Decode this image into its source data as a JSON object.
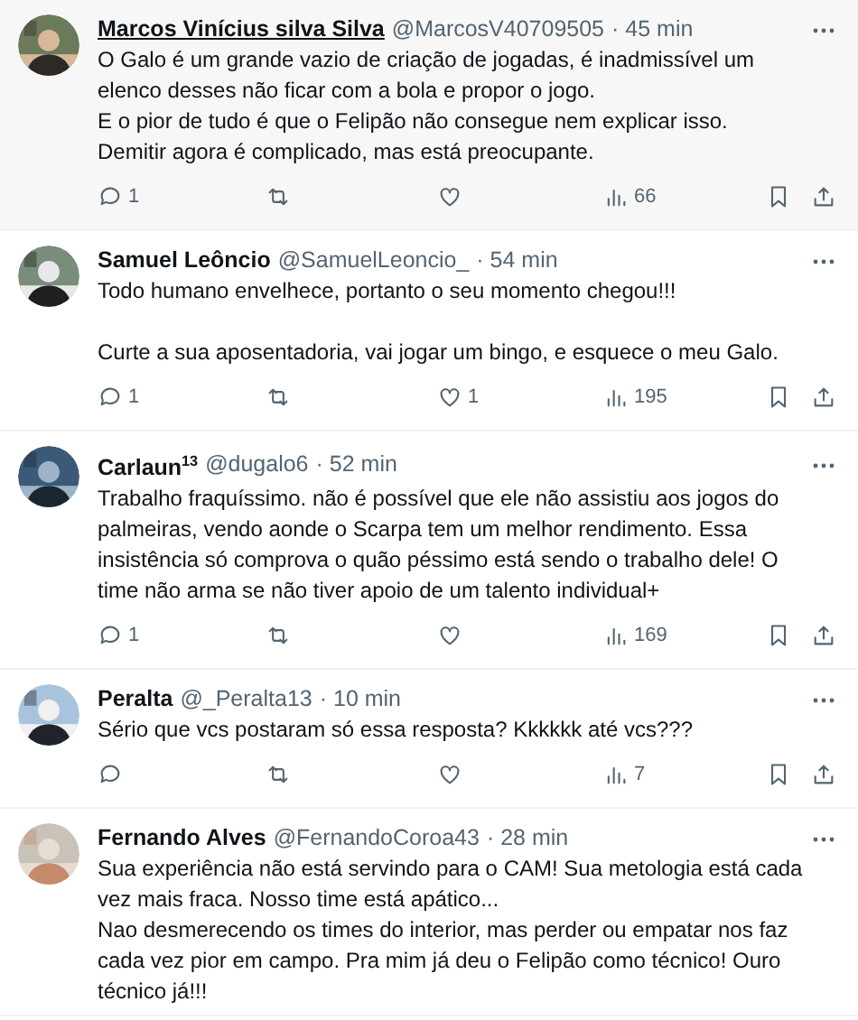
{
  "tweets": [
    {
      "name": "Marcos Vinícius silva Silva",
      "handle": "@MarcosV40709505",
      "time": "· 45 min",
      "hovered": true,
      "blocks": [
        [
          "O Galo é um grande vazio de criação de jogadas, é inadmissível um elenco desses não ficar com a bola e propor o jogo.",
          "E o pior de tudo é que o Felipão não consegue nem explicar isso.",
          "Demitir agora é complicado, mas está preocupante."
        ]
      ],
      "actions": {
        "replies": "1",
        "views": "66"
      }
    },
    {
      "name": "Samuel Leôncio",
      "handle": "@SamuelLeoncio_",
      "time": "· 54 min",
      "hovered": false,
      "blocks": [
        [
          "Todo humano envelhece, portanto o seu momento chegou!!!"
        ],
        [
          "Curte a sua aposentadoria, vai jogar um bingo, e esquece o meu Galo."
        ]
      ],
      "actions": {
        "replies": "1",
        "likes": "1",
        "views": "195"
      }
    },
    {
      "name": "Carlaun$^{13}$",
      "handle": "@dugalo6",
      "time": "· 52 min",
      "hovered": false,
      "blocks": [
        [
          "Trabalho fraquíssimo. não é possível que ele não assistiu aos jogos do palmeiras, vendo aonde o Scarpa tem um melhor rendimento. Essa insistência só comprova o quão péssimo está sendo o trabalho dele! O time não arma se não tiver apoio de um talento individual+"
        ]
      ],
      "actions": {
        "replies": "1",
        "views": "169"
      }
    },
    {
      "name": "Peralta",
      "handle": "@_Peralta13",
      "time": "· 10 min",
      "hovered": false,
      "blocks": [
        [
          "Sério que vcs postaram só essa resposta? Kkkkkk até vcs???"
        ]
      ],
      "actions": {
        "views": "7"
      }
    },
    {
      "name": "Fernando Alves",
      "handle": "@FernandoCoroa43",
      "time": "· 28 min",
      "hovered": false,
      "blocks": [
        [
          "Sua experiência não está servindo para o CAM! Sua metologia está cada vez mais fraca. Nosso time está apático...",
          "Nao desmerecendo os times do interior, mas perder ou empatar nos faz cada vez pior em campo. Pra mim já deu o Felipão como técnico! Ouro técnico já!!!"
        ]
      ]
    }
  ]
}
